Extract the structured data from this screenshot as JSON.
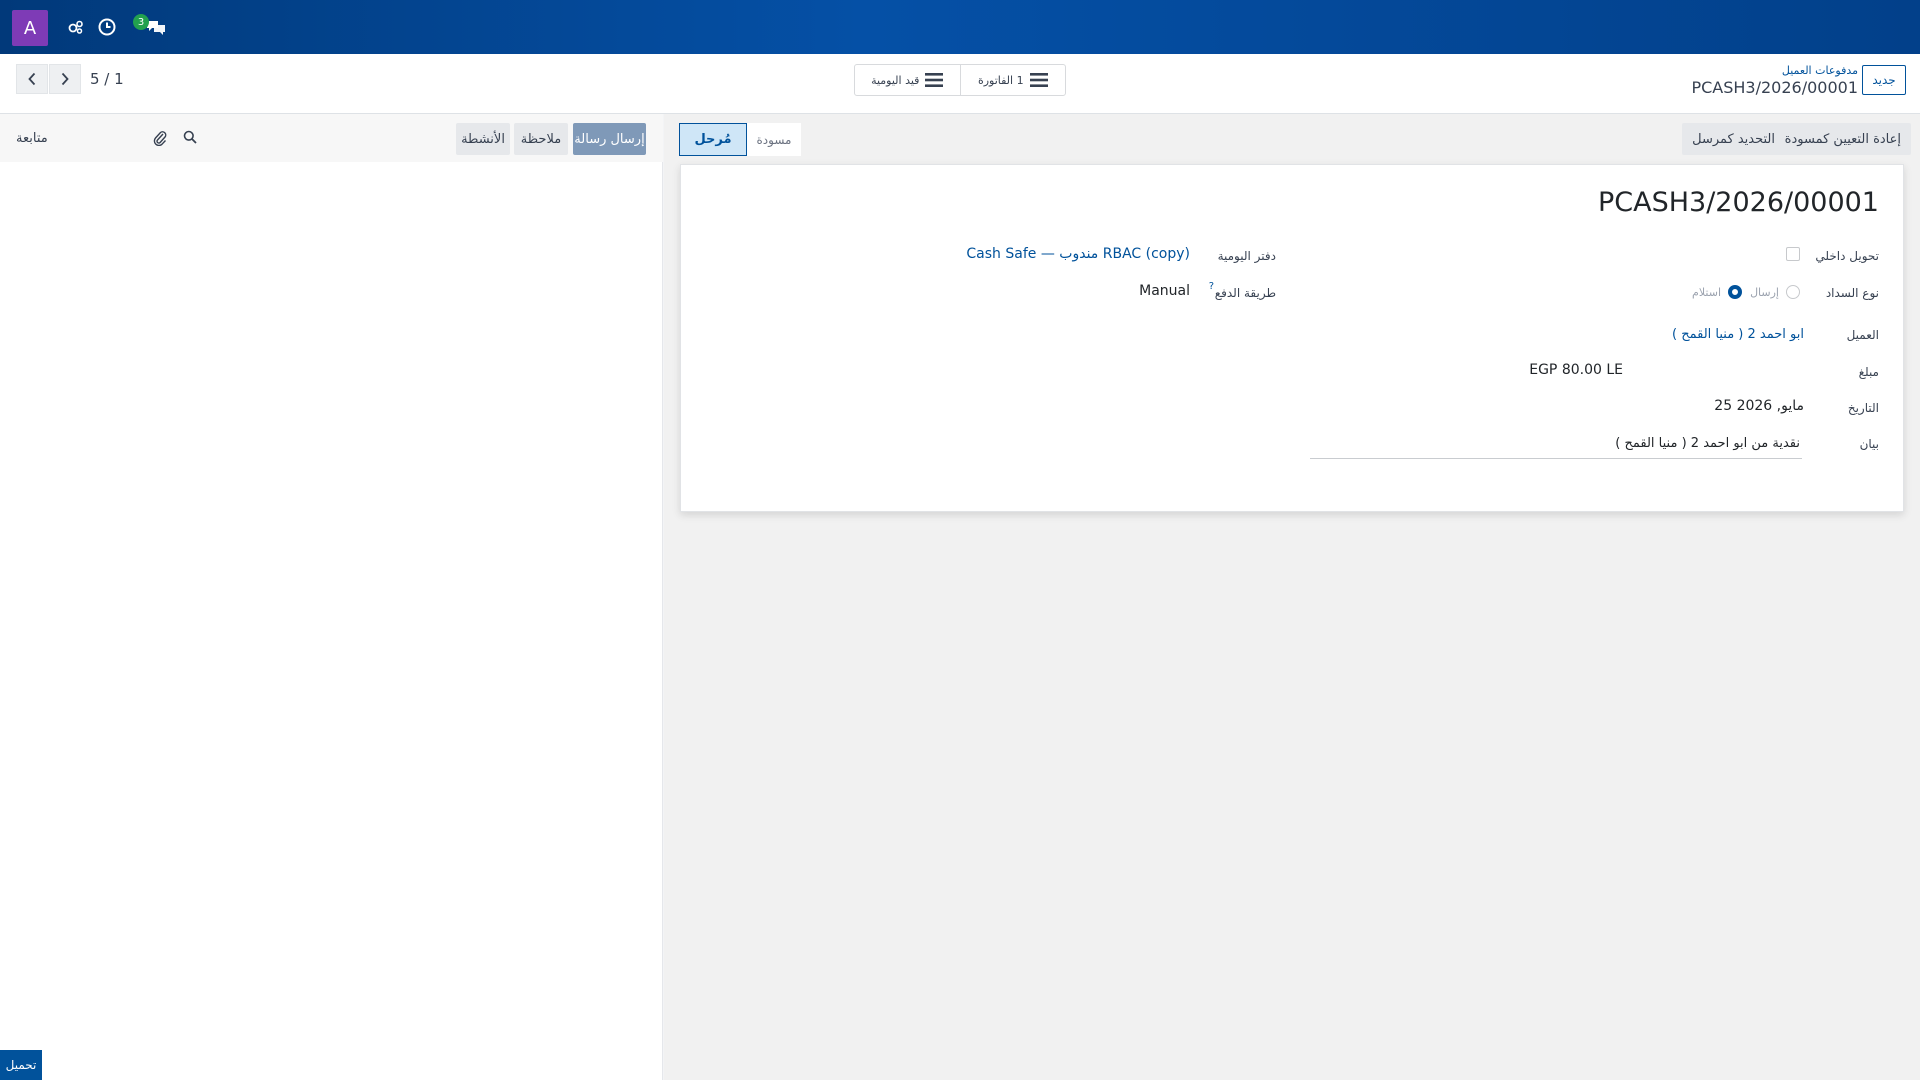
{
  "navbar": {
    "avatar_letter": "A",
    "chat_count": "3",
    "icons": [
      "bug-icon",
      "clock-icon",
      "chat-icon"
    ],
    "background": "#01397a"
  },
  "control": {
    "pager": "5 / 1",
    "smart_buttons": [
      {
        "label": "1 الفاتورة",
        "icon": "list-icon"
      },
      {
        "label": "قيد اليومية",
        "icon": "list-icon"
      }
    ],
    "breadcrumb": "مدفوعات العميل",
    "record": "PCASH3/2026/00001",
    "new_label": "جديد"
  },
  "chatter": {
    "send_message": "إرسال رسالة",
    "log_note": "ملاحظة",
    "activities": "الأنشطة",
    "follow": "متابعة",
    "accent": "#7f99b8"
  },
  "statusbar": {
    "reset_to_draft": "إعادة التعيين كمسودة",
    "mark_as_sent": "التحديد كمرسل",
    "stage_posted": "مُرحل",
    "stage_draft": "مسودة"
  },
  "form": {
    "title": "PCASH3/2026/00001",
    "internal_transfer_label": "تحويل داخلي",
    "payment_type_label": "نوع السداد",
    "payment_type_options": [
      "إرسال",
      "استلام"
    ],
    "payment_type_selected": "استلام",
    "customer_label": "العميل",
    "customer_value": "ابو احمد 2 ( منيا القمح )",
    "amount_label": "مبلغ",
    "amount_value": "EGP 80.00 LE",
    "date_label": "التاريخ",
    "date_value": "25 مايو, 2026",
    "memo_label": "بيان",
    "memo_value": "نقدية من ابو احمد 2 ( منيا القمح )",
    "journal_label": "دفتر اليومية",
    "journal_value": "Cash Safe — مندوب RBAC (copy)",
    "payment_method_label": "طريقة الدفع",
    "payment_method_help": "?",
    "payment_method_value": "Manual"
  },
  "footer": {
    "loading": "تحميل"
  }
}
